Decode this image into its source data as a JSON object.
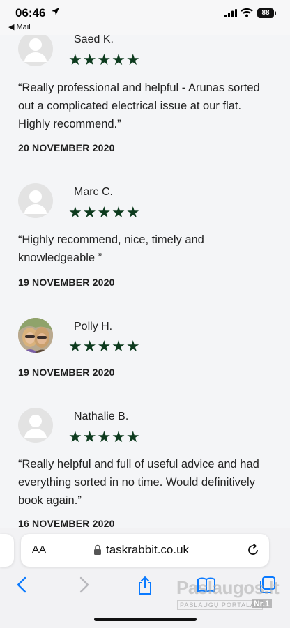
{
  "status_bar": {
    "time": "06:46",
    "back_app": "Mail",
    "battery": "88"
  },
  "reviews": [
    {
      "name": "Saed K.",
      "stars": "★★★★★",
      "rating": 5,
      "quote": "“Really professional and helpful - Arunas sorted out a complicated electrical issue at our flat. Highly recommend.”",
      "date": "20 NOVEMBER 2020"
    },
    {
      "name": "Marc C.",
      "stars": "★★★★★",
      "rating": 5,
      "quote": "“Highly recommend, nice, timely and knowledgeable ”",
      "date": "19 NOVEMBER 2020"
    },
    {
      "name": "Polly H.",
      "stars": "★★★★★",
      "rating": 5,
      "quote": "",
      "date": "19 NOVEMBER 2020"
    },
    {
      "name": "Nathalie B.",
      "stars": "★★★★★",
      "rating": 5,
      "quote": "“Really helpful and full of useful advice and had everything sorted in no time. Would definitively book again.”",
      "date": "16 NOVEMBER 2020"
    }
  ],
  "browser": {
    "aa_label": "AA",
    "url": "taskrabbit.co.uk"
  },
  "watermark": {
    "title": "Paslaugos.lt",
    "subtitle": "PASLAUGŲ PORTALAS",
    "badge": "Nr.1"
  },
  "colors": {
    "star": "#0d3b1e",
    "accent": "#0a7aff",
    "background": "#f4f5f7"
  }
}
